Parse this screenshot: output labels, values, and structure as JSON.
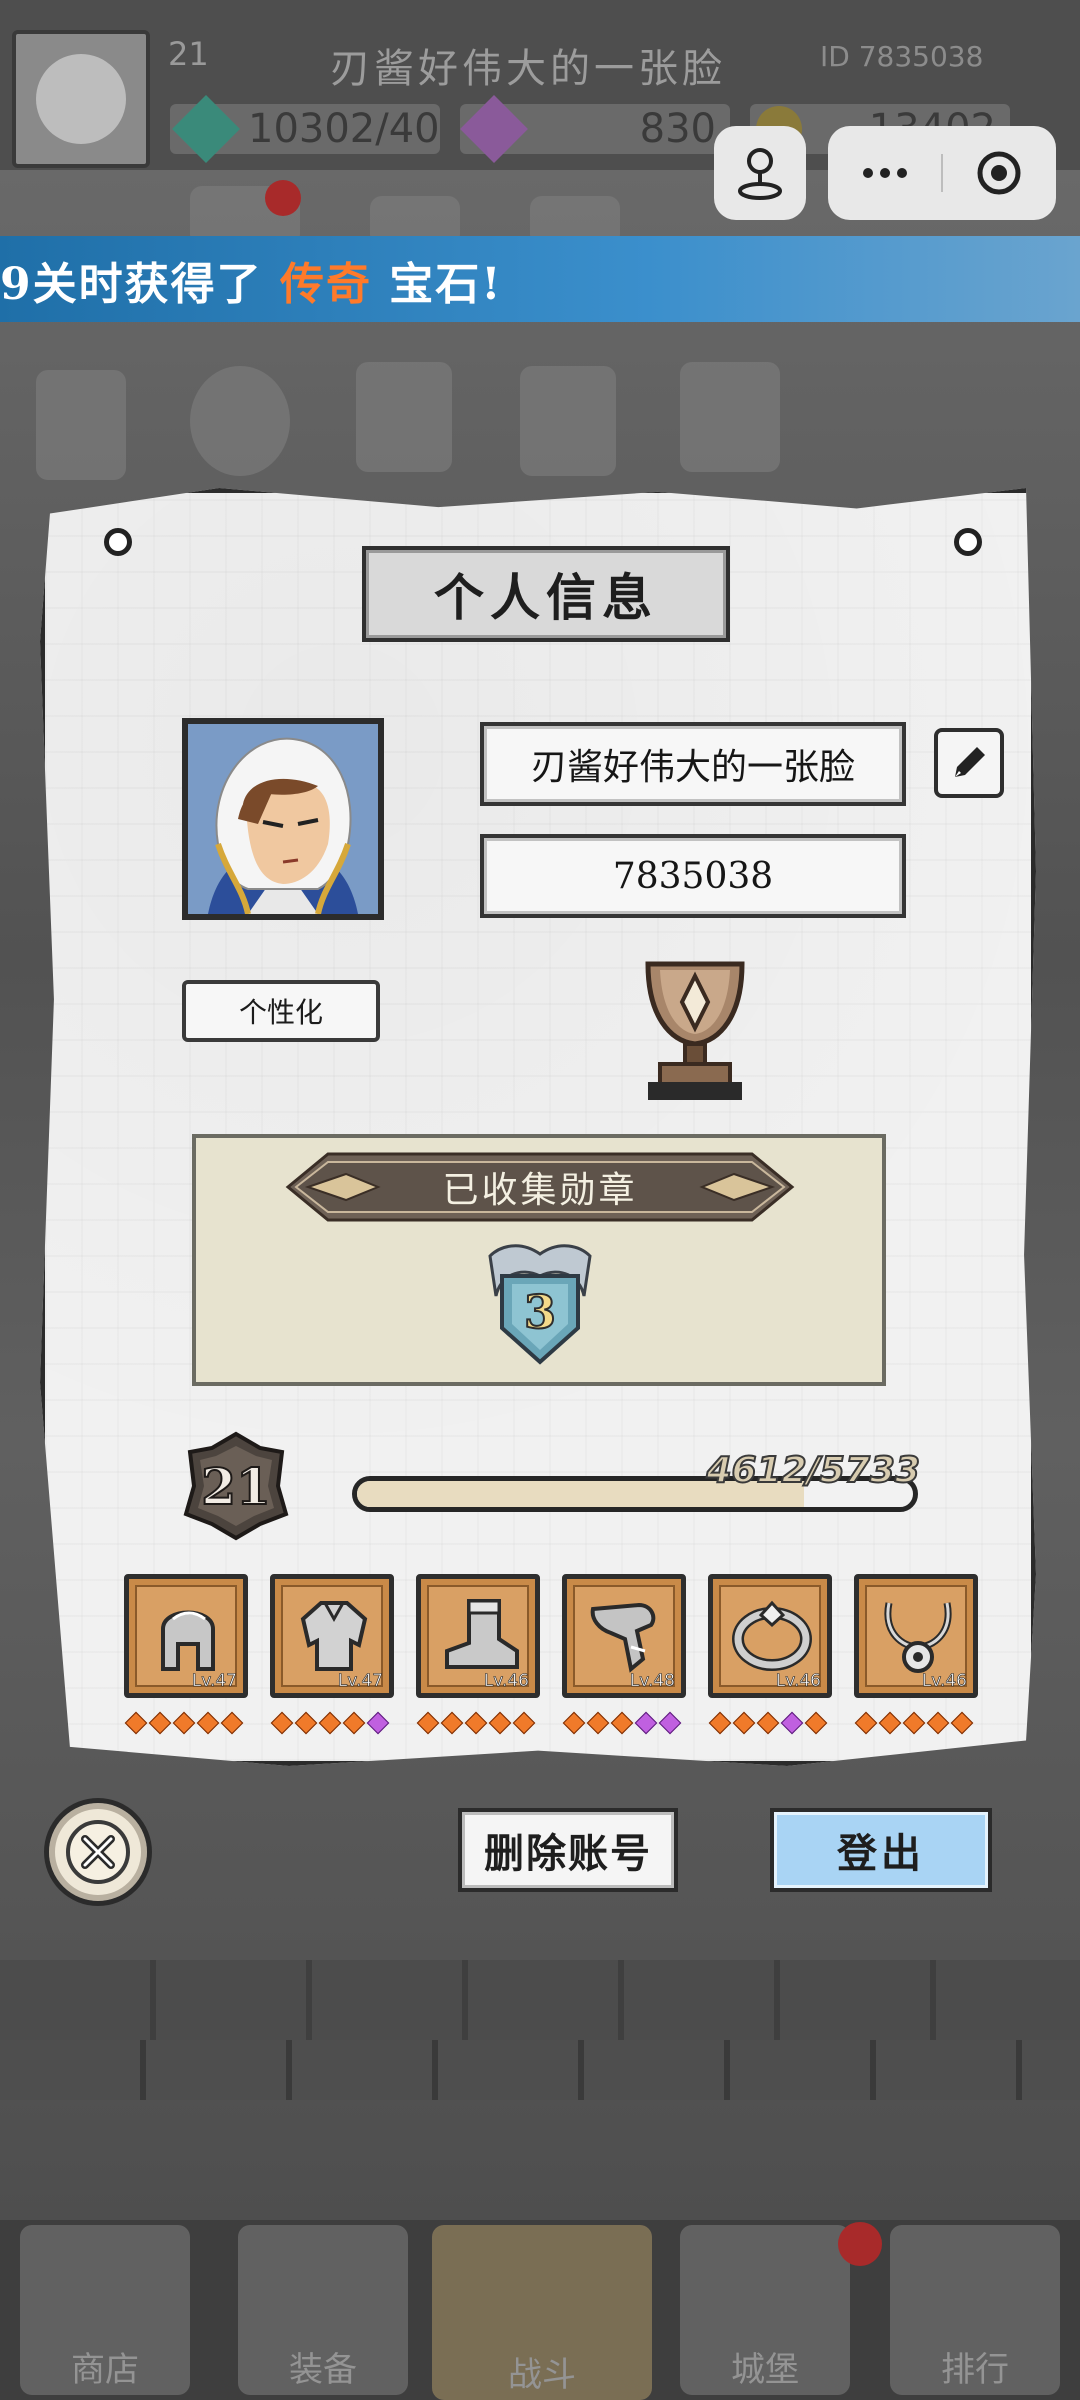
{
  "background": {
    "player_level": "21",
    "player_name": "刃酱好伟大的一张脸",
    "player_id_short": "ID 7835038",
    "resources": [
      {
        "value": "10302/40",
        "icon": "emerald-gem-icon"
      },
      {
        "value": "830",
        "icon": "purple-diamond-icon"
      },
      {
        "value": "13402",
        "icon": "gold-coin-icon"
      }
    ],
    "ticker": {
      "prefix": "9关时获得了",
      "highlight": "传奇",
      "suffix": "宝石!"
    },
    "nav": [
      {
        "label": "商店",
        "icon": "shop-icon"
      },
      {
        "label": "装备",
        "icon": "equipment-icon"
      },
      {
        "label": "战斗",
        "icon": "crossed-swords-icon"
      },
      {
        "label": "城堡",
        "icon": "castle-icon"
      },
      {
        "label": "排行",
        "icon": "ranking-icon"
      }
    ]
  },
  "capsule": {
    "menu_icon": "more-dots-icon",
    "close_icon": "target-circle-icon",
    "game_icon": "joystick-icon"
  },
  "dialog": {
    "title": "个人信息",
    "nickname": "刃酱好伟大的一张脸",
    "player_id": "7835038",
    "customize_label": "个性化",
    "medal_section_title": "已收集勋章",
    "medal_count": "3",
    "level": "21",
    "xp_text": "4612/5733",
    "xp_current": 4612,
    "xp_max": 5733,
    "equipment": [
      {
        "name": "helmet",
        "lv": "Lv.47",
        "stars": [
          "o",
          "o",
          "o",
          "o",
          "o"
        ]
      },
      {
        "name": "armor",
        "lv": "Lv.47",
        "stars": [
          "o",
          "o",
          "o",
          "o",
          "p"
        ]
      },
      {
        "name": "boots",
        "lv": "Lv.46",
        "stars": [
          "o",
          "o",
          "o",
          "o",
          "o"
        ]
      },
      {
        "name": "gauntlet",
        "lv": "Lv.48",
        "stars": [
          "o",
          "o",
          "o",
          "p",
          "p"
        ]
      },
      {
        "name": "ring",
        "lv": "Lv.46",
        "stars": [
          "o",
          "o",
          "o",
          "p",
          "o"
        ]
      },
      {
        "name": "necklace",
        "lv": "Lv.46",
        "stars": [
          "o",
          "o",
          "o",
          "o",
          "o"
        ]
      }
    ],
    "delete_account_label": "删除账号",
    "logout_label": "登出"
  },
  "colors": {
    "accent_blue": "#a9d4f4",
    "ticker_highlight": "#ff7a2a",
    "equip_bg": "#c98a48"
  }
}
